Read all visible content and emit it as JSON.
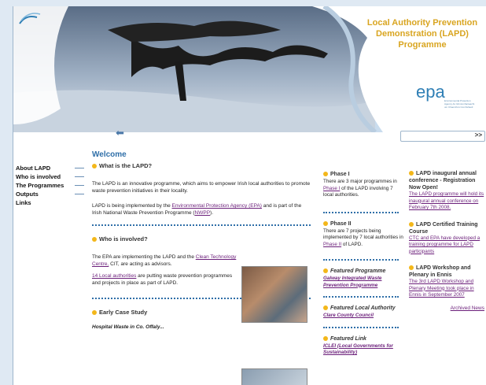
{
  "header": {
    "title_lines": [
      "Local Authority Prevention",
      "Demonstration (LAPD)",
      "Programme"
    ],
    "logo_text": "epa",
    "logo_subtext": "Environmental Protection Agency An Ghníomhaireacht um Chaomhnú Comhshaoil"
  },
  "nav": {
    "back_icon": "arrow-left-icon",
    "go_label": ">>"
  },
  "sidebar": {
    "items": [
      {
        "label": "About LAPD"
      },
      {
        "label": "Who is involved"
      },
      {
        "label": "The Programmes"
      },
      {
        "label": "Outputs"
      },
      {
        "label": "Links"
      }
    ]
  },
  "main": {
    "welcome": "Welcome",
    "s1": {
      "title": "What is the LAPD?",
      "p1": "The LAPD is an innovative programme, which aims to empower Irish local authorities to promote waste prevention initiatives in their locality.",
      "p2_pre": "LAPD is being implemented by the ",
      "p2_link": "Environmental Protection Agency (EPA)",
      "p2_mid": " and is part of the Irish National Waste Prevention Programme (",
      "p2_link2": "NWPP",
      "p2_post": ")."
    },
    "s2": {
      "title": "Who is involved?",
      "p1_pre": "The EPA are implementing the LAPD and the ",
      "p1_link": "Clean Technology Centre,",
      "p1_post": " CIT, are acting as advisors.",
      "p2_link": "14 Local authorities",
      "p2_post": " are putting waste prevention programmes and projects in place as part of LAPD."
    },
    "s3": {
      "title": "Early Case Study",
      "p1": "Hospital Waste in Co. Offaly..."
    }
  },
  "col3": {
    "phase1_title": "Phase I",
    "phase1_pre": "There are 3 major programmes in ",
    "phase1_link": "Phase I",
    "phase1_post": " of the LAPD involving 7 local authorities.",
    "phase2_title": "Phase II",
    "phase2_pre": "There are 7 projects being implemented by 7 local authorities in ",
    "phase2_link": "Phase II",
    "phase2_post": " of LAPD.",
    "feat_prog_title": "Featured Programme",
    "feat_prog_link": "Galway Integrated Waste Prevention Programme",
    "feat_la_title": "Featured Local Authority",
    "feat_la_link": "Clare County Council",
    "feat_link_title": "Featured Link",
    "feat_link_link": "ICLEI (Local Governments for Sustainability)"
  },
  "col4": {
    "n1_title": "LAPD inaugural annual conference - Registration Now Open!",
    "n1_link": "The LAPD programme will hold its inaugural annual conference on February 7th 2008.",
    "n2_title": "LAPD Certified Training Course",
    "n2_link": "CTC and EPA have developed a training programme for LAPD participants",
    "n3_title": "LAPD Workshop and Plenary in Ennis",
    "n3_link": "The 3rd LAPD Workshop and Plenary Meeting took place in Ennis in September 2007",
    "archived": "Archived News"
  },
  "colors": {
    "accent_blue": "#2f6fa8",
    "gold": "#d9a520",
    "link_purple": "#6b1f7a",
    "bullet": "#f3b71a"
  }
}
